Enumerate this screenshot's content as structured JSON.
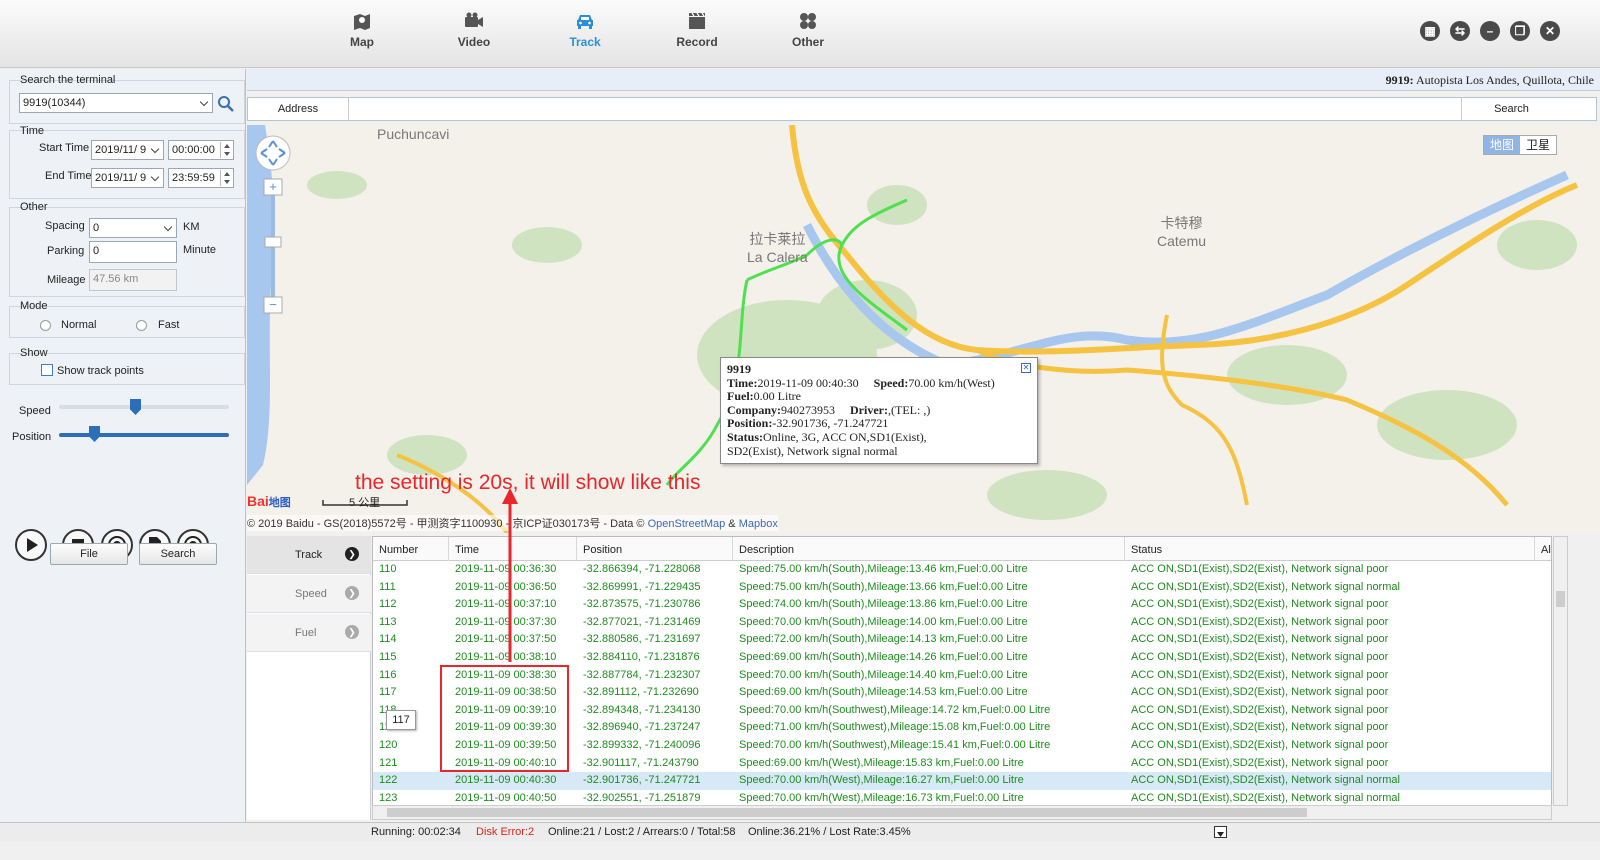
{
  "nav": {
    "items": [
      {
        "label": "Map",
        "icon": "map-pin-icon"
      },
      {
        "label": "Video",
        "icon": "video-camera-icon"
      },
      {
        "label": "Track",
        "icon": "car-icon"
      },
      {
        "label": "Record",
        "icon": "film-clapper-icon"
      },
      {
        "label": "Other",
        "icon": "grid-icon"
      }
    ],
    "active": "Track",
    "accent": "#2a8fd8"
  },
  "left": {
    "search_label": "Search the terminal",
    "terminal_value": "9919(10344)",
    "time_label": "Time",
    "start_label": "Start Time",
    "start_date": "2019/11/ 9",
    "start_time": "00:00:00",
    "end_label": "End Time",
    "end_date": "2019/11/ 9",
    "end_time": "23:59:59",
    "other_label": "Other",
    "spacing_label": "Spacing",
    "spacing_value": "0",
    "spacing_unit": "KM",
    "parking_label": "Parking",
    "parking_value": "0",
    "parking_unit": "Minute",
    "mileage_label": "Mileage",
    "mileage_value": "47.56 km",
    "mode_label": "Mode",
    "mode_normal": "Normal",
    "mode_fast": "Fast",
    "show_label": "Show",
    "show_track_points": "Show track points",
    "speed_label": "Speed",
    "position_label": "Position",
    "file_button": "File",
    "search_button": "Search"
  },
  "address": {
    "location_bold": "9919:",
    "location_text": " Autopista Los Andes, Quillota, Chile",
    "field_label": "Address",
    "search_button": "Search"
  },
  "map": {
    "places": [
      {
        "name": "Puchuncavi"
      },
      {
        "name": "拉卡莱拉",
        "sub": "La Calera"
      },
      {
        "name": "卡特穆",
        "sub": "Catemu"
      }
    ],
    "maptype": [
      "地图",
      "卫星"
    ],
    "scale": "5 公里",
    "copyright": "© 2019 Baidu - GS(2018)5572号 - 甲测资字1100930 - 京ICP证030173号 - Data © ",
    "osm": "OpenStreetMap",
    "amp": " & ",
    "mapbox": "Mapbox",
    "logo": "Bai",
    "logo2": "地图"
  },
  "popup": {
    "title": "9919",
    "time_label": "Time:",
    "time_value": "2019-11-09 00:40:30",
    "speed_label": "Speed:",
    "speed_value": "70.00 km/h(West)",
    "fuel_label": "Fuel:",
    "fuel_value": "0.00 Litre",
    "company_label": "Company:",
    "company_value": "940273953",
    "driver_label": "Driver:",
    "driver_value": ",(TEL: ,)",
    "position_label": "Position:",
    "position_value": "-32.901736, -71.247721",
    "status_label": "Status:",
    "status_value": "Online, 3G, ACC ON,SD1(Exist),",
    "status_value2": "SD2(Exist), Network signal normal"
  },
  "annotation": "the setting is 20s, it will show like this",
  "tooltip": "117",
  "tabs": [
    "Track",
    "Speed",
    "Fuel"
  ],
  "table": {
    "headers": [
      "Number",
      "Time",
      "Position",
      "Description",
      "Status",
      "Al"
    ],
    "rows": [
      [
        "110",
        "2019-11-09 00:36:30",
        "-32.866394, -71.228068",
        "Speed:75.00 km/h(South),Mileage:13.46 km,Fuel:0.00 Litre",
        "ACC ON,SD1(Exist),SD2(Exist), Network signal poor"
      ],
      [
        "111",
        "2019-11-09 00:36:50",
        "-32.869991, -71.229435",
        "Speed:75.00 km/h(South),Mileage:13.66 km,Fuel:0.00 Litre",
        "ACC ON,SD1(Exist),SD2(Exist), Network signal normal"
      ],
      [
        "112",
        "2019-11-09 00:37:10",
        "-32.873575, -71.230786",
        "Speed:74.00 km/h(South),Mileage:13.86 km,Fuel:0.00 Litre",
        "ACC ON,SD1(Exist),SD2(Exist), Network signal poor"
      ],
      [
        "113",
        "2019-11-09 00:37:30",
        "-32.877021, -71.231469",
        "Speed:70.00 km/h(South),Mileage:14.00 km,Fuel:0.00 Litre",
        "ACC ON,SD1(Exist),SD2(Exist), Network signal poor"
      ],
      [
        "114",
        "2019-11-09 00:37:50",
        "-32.880586, -71.231697",
        "Speed:72.00 km/h(South),Mileage:14.13 km,Fuel:0.00 Litre",
        "ACC ON,SD1(Exist),SD2(Exist), Network signal poor"
      ],
      [
        "115",
        "2019-11-09 00:38:10",
        "-32.884110, -71.231876",
        "Speed:69.00 km/h(South),Mileage:14.26 km,Fuel:0.00 Litre",
        "ACC ON,SD1(Exist),SD2(Exist), Network signal poor"
      ],
      [
        "116",
        "2019-11-09 00:38:30",
        "-32.887784, -71.232307",
        "Speed:70.00 km/h(South),Mileage:14.40 km,Fuel:0.00 Litre",
        "ACC ON,SD1(Exist),SD2(Exist), Network signal poor"
      ],
      [
        "117",
        "2019-11-09 00:38:50",
        "-32.891112, -71.232690",
        "Speed:69.00 km/h(South),Mileage:14.53 km,Fuel:0.00 Litre",
        "ACC ON,SD1(Exist),SD2(Exist), Network signal poor"
      ],
      [
        "118",
        "2019-11-09 00:39:10",
        "-32.894348, -71.234130",
        "Speed:70.00 km/h(Southwest),Mileage:14.72 km,Fuel:0.00 Litre",
        "ACC ON,SD1(Exist),SD2(Exist), Network signal poor"
      ],
      [
        "119",
        "2019-11-09 00:39:30",
        "-32.896940, -71.237247",
        "Speed:71.00 km/h(Southwest),Mileage:15.08 km,Fuel:0.00 Litre",
        "ACC ON,SD1(Exist),SD2(Exist), Network signal poor"
      ],
      [
        "120",
        "2019-11-09 00:39:50",
        "-32.899332, -71.240096",
        "Speed:70.00 km/h(Southwest),Mileage:15.41 km,Fuel:0.00 Litre",
        "ACC ON,SD1(Exist),SD2(Exist), Network signal poor"
      ],
      [
        "121",
        "2019-11-09 00:40:10",
        "-32.901117, -71.243790",
        "Speed:69.00 km/h(West),Mileage:15.83 km,Fuel:0.00 Litre",
        "ACC ON,SD1(Exist),SD2(Exist), Network signal poor"
      ],
      [
        "122",
        "2019-11-09 00:40:30",
        "-32.901736, -71.247721",
        "Speed:70.00 km/h(West),Mileage:16.27 km,Fuel:0.00 Litre",
        "ACC ON,SD1(Exist),SD2(Exist), Network signal normal"
      ],
      [
        "123",
        "2019-11-09 00:40:50",
        "-32.902551, -71.251879",
        "Speed:70.00 km/h(West),Mileage:16.73 km,Fuel:0.00 Litre",
        "ACC ON,SD1(Exist),SD2(Exist), Network signal normal"
      ]
    ],
    "selected_row": "122",
    "row_color": "#1d8d1d"
  },
  "status": {
    "running": "Running: 00:02:34",
    "disk_error": "Disk Error:2",
    "online": "Online:21 / Lost:2 / Arrears:0 / Total:58",
    "rate": "Online:36.21% / Lost Rate:3.45%"
  }
}
